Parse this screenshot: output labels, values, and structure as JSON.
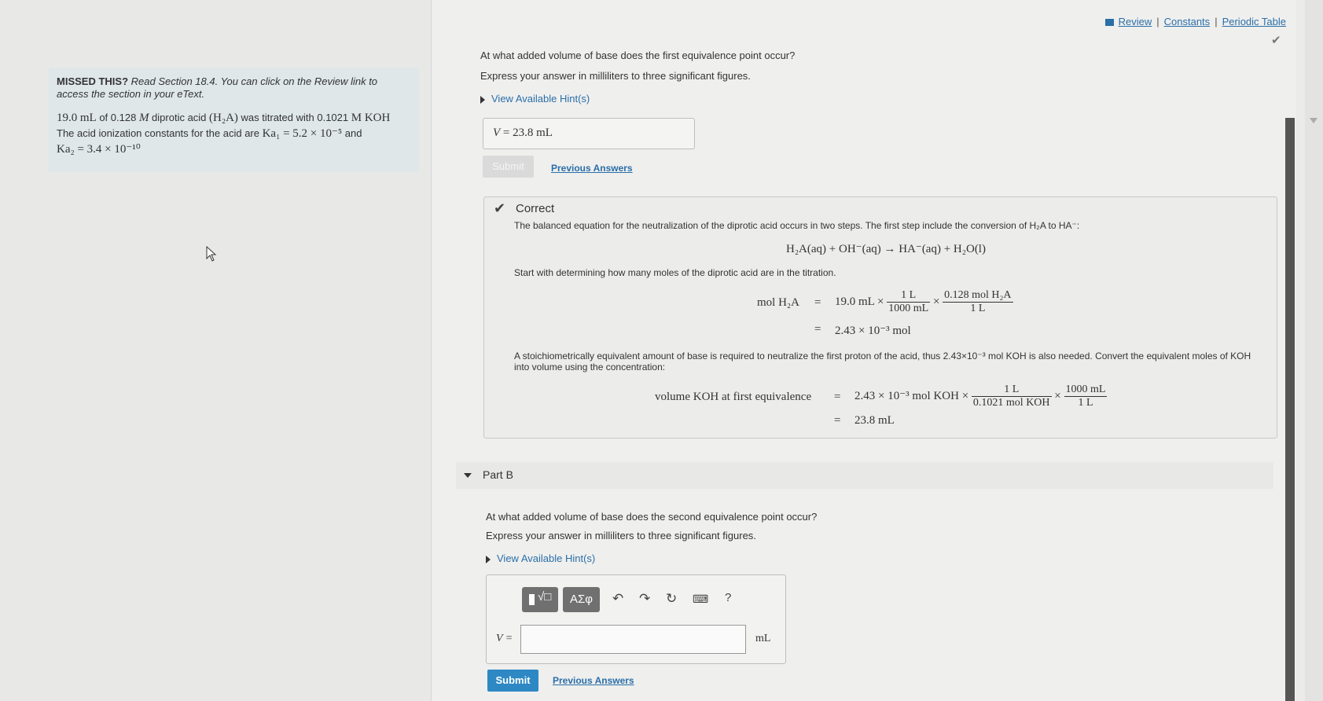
{
  "links": {
    "review": "Review",
    "constants": "Constants",
    "periodic": "Periodic Table"
  },
  "missed": {
    "lead": "MISSED THIS?",
    "text": "Read Section 18.4. You can click on the Review link to access the section in your eText.",
    "p1": "19.0",
    "p1u": "mL",
    "p2": " of 0.128 ",
    "p2u": "M",
    "p3": " diprotic acid ",
    "acid": "(H₂A)",
    "p4": " was titrated with 0.1021 ",
    "koh": "M KOH",
    "p5": "The acid ionization constants for the acid are ",
    "ka1": "Ka₁ = 5.2 × 10⁻⁵",
    "p6": " and",
    "ka2": "Ka₂ = 3.4 × 10⁻¹⁰"
  },
  "partA": {
    "question": "At what added volume of base does the first equivalence point occur?",
    "express": "Express your answer in milliliters to three significant figures.",
    "hint": "View Available Hint(s)",
    "answer_var": "V",
    "answer_eq": "=",
    "answer_val": "23.8",
    "answer_unit": "mL",
    "submit": "Submit",
    "prev": "Previous Answers"
  },
  "correct": {
    "title": "Correct",
    "t1": "The balanced equation for the neutralization of the diprotic acid occurs in two steps. The first step include the conversion of H₂A to HA⁻:",
    "eq1": "H₂A(aq) + OH⁻(aq) → HA⁻(aq) + H₂O(l)",
    "t2": "Start with determining how many moles of the diprotic acid are in the titration.",
    "mol_label": "mol H₂A",
    "mol_eq": "=",
    "mol_a": "19.0 mL ×",
    "f1n": "1 L",
    "f1d": "1000 mL",
    "times": "×",
    "f2n": "0.128 mol H₂A",
    "f2d": "1 L",
    "mol_res": "2.43 × 10⁻³ mol",
    "t3": "A stoichiometrically equivalent amount of base is required to neutralize the first proton of the acid, thus 2.43×10⁻³ mol KOH is also needed. Convert the equivalent moles of KOH into volume using the concentration:",
    "vol_label": "volume KOH at first equivalence",
    "vol_a": "2.43 × 10⁻³ mol KOH ×",
    "f3n": "1 L",
    "f3d": "0.1021 mol KOH",
    "f4n": "1000 mL",
    "f4d": "1 L",
    "vol_res": "23.8 mL"
  },
  "partB": {
    "title": "Part B",
    "question": "At what added volume of base does the second equivalence point occur?",
    "express": "Express your answer in milliliters to three significant figures.",
    "hint": "View Available Hint(s)",
    "greek": "AΣφ",
    "help": "?",
    "var": "V =",
    "unit": "mL",
    "submit": "Submit",
    "prev": "Previous Answers"
  }
}
